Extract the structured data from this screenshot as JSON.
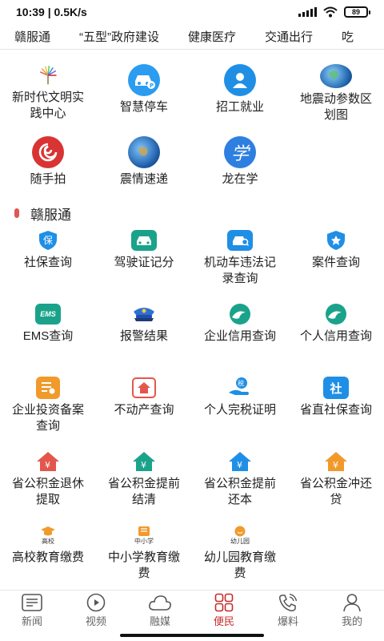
{
  "status": {
    "time": "10:39",
    "speed": "0.5K/s",
    "battery": "89"
  },
  "categories": [
    "赣服通",
    "“五型”政府建设",
    "健康医疗",
    "交通出行",
    "吃"
  ],
  "top_services": [
    {
      "label": "新时代文明实践中心"
    },
    {
      "label": "智慧停车"
    },
    {
      "label": "招工就业"
    },
    {
      "label": "地震动参数区划图"
    },
    {
      "label": "随手拍"
    },
    {
      "label": "震情速递"
    },
    {
      "label": "龙在学"
    }
  ],
  "section": {
    "title": "赣服通"
  },
  "services": [
    {
      "label": "社保查询",
      "icon_text": "保"
    },
    {
      "label": "驾驶证记分"
    },
    {
      "label": "机动车违法记录查询"
    },
    {
      "label": "案件查询"
    },
    {
      "label": "EMS查询",
      "icon_text": "EMS"
    },
    {
      "label": "报警结果"
    },
    {
      "label": "企业信用查询"
    },
    {
      "label": "个人信用查询"
    },
    {
      "label": "企业投资备案查询"
    },
    {
      "label": "不动产查询"
    },
    {
      "label": "个人完税证明",
      "icon_text": "税"
    },
    {
      "label": "省直社保查询",
      "icon_text": "社"
    },
    {
      "label": "省公积金退休提取",
      "icon_text": "¥"
    },
    {
      "label": "省公积金提前结清",
      "icon_text": "¥"
    },
    {
      "label": "省公积金提前还本",
      "icon_text": "¥"
    },
    {
      "label": "省公积金冲还贷",
      "icon_text": "¥"
    },
    {
      "label": "高校教育缴费",
      "icon_text": "高校"
    },
    {
      "label": "中小学教育缴费",
      "icon_text": "中小学"
    },
    {
      "label": "幼儿园教育缴费",
      "icon_text": "幼儿园"
    }
  ],
  "tabbar": [
    {
      "label": "新闻"
    },
    {
      "label": "视频"
    },
    {
      "label": "融媒"
    },
    {
      "label": "便民",
      "active": true
    },
    {
      "label": "爆料"
    },
    {
      "label": "我的"
    }
  ],
  "colors": {
    "accent": "#c62a2a",
    "blue": "#1f8fe6",
    "teal": "#1aa38a",
    "red": "#e2574c",
    "orange": "#f19a2c"
  }
}
